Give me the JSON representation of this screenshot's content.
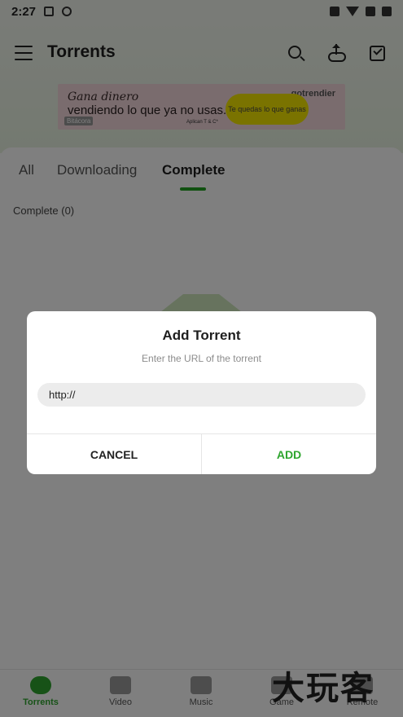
{
  "status_bar": {
    "time": "2:27"
  },
  "header": {
    "title": "Torrents"
  },
  "ad": {
    "line1": "Gana dinero",
    "line2": "vendiendo lo que ya no usas.",
    "brand": "gotrendier",
    "pill_text": "Te quedas lo que ganas",
    "tag": "Bitácora",
    "small_print": "Aplican T & C*"
  },
  "tabs": [
    {
      "label": "All",
      "active": false
    },
    {
      "label": "Downloading",
      "active": false
    },
    {
      "label": "Complete",
      "active": true
    }
  ],
  "section": {
    "label": "Complete (0)"
  },
  "dialog": {
    "title": "Add Torrent",
    "subtitle": "Enter the URL of the torrent",
    "input_value": "http://",
    "cancel_label": "CANCEL",
    "add_label": "ADD"
  },
  "bottom_nav": [
    {
      "label": "Torrents",
      "icon": "torrents-cloud-icon",
      "active": true
    },
    {
      "label": "Video",
      "icon": "video-icon",
      "active": false
    },
    {
      "label": "Music",
      "icon": "music-icon",
      "active": false
    },
    {
      "label": "Game",
      "icon": "game-controller-icon",
      "active": false
    },
    {
      "label": "Remote",
      "icon": "remote-icon",
      "active": false
    }
  ],
  "watermark": {
    "text": "大玩客"
  },
  "colors": {
    "accent": "#2ea52e",
    "header_bg": "#eef5e8",
    "scrim": "rgba(0,0,0,0.5)"
  }
}
